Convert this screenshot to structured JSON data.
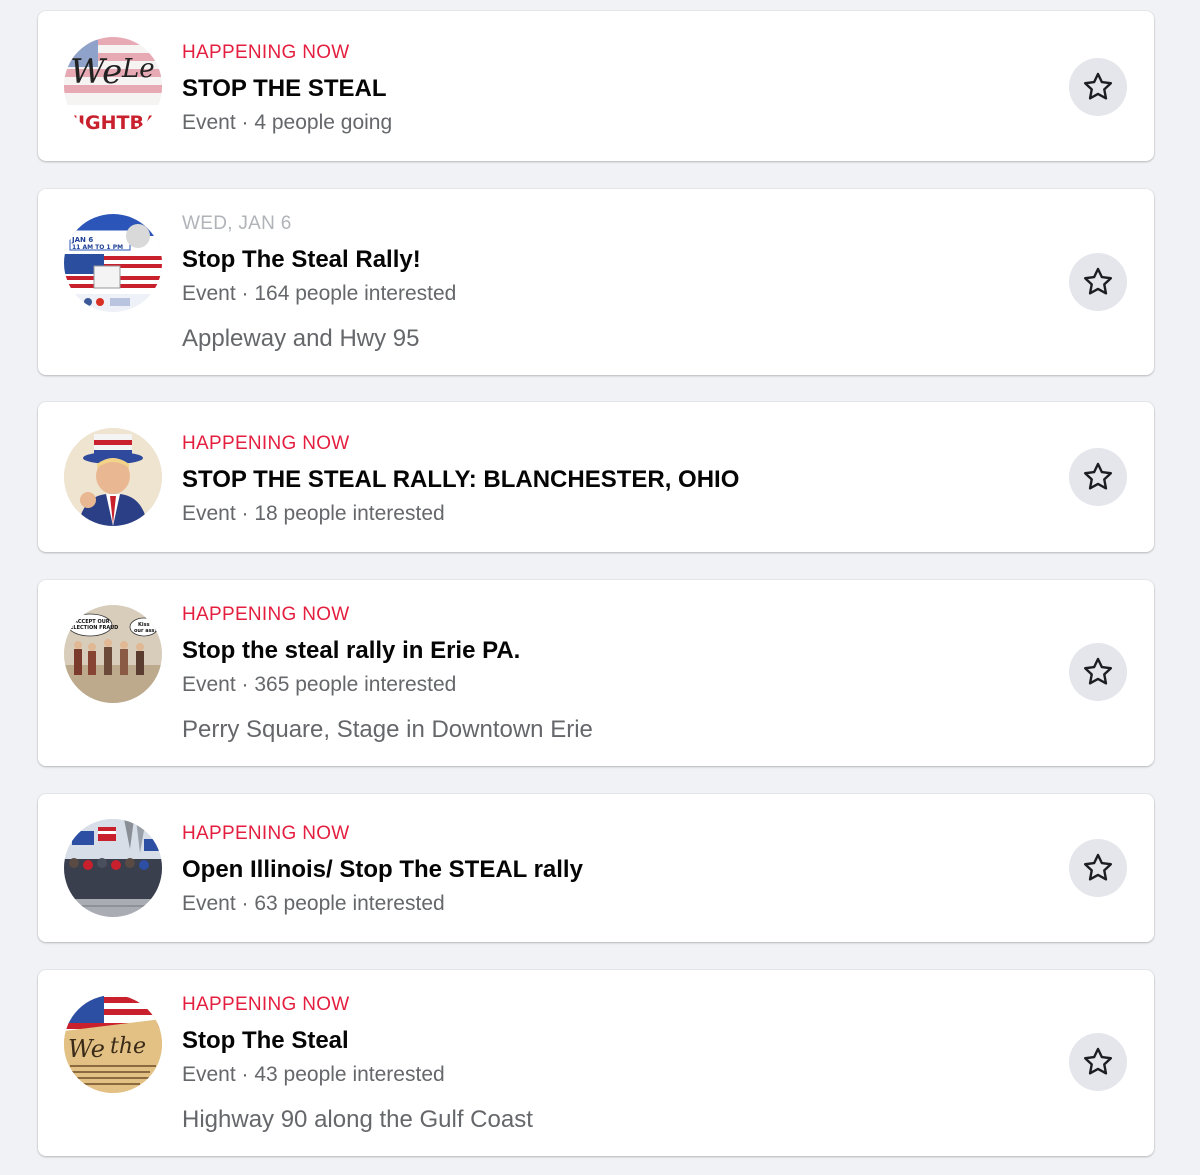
{
  "events": [
    {
      "when": "HAPPENING NOW",
      "when_type": "live",
      "title": "STOP THE STEAL",
      "meta": "Event · 4 people going",
      "location": "",
      "thumb_icon": "we-the-people-flag-image",
      "thumb_text": "FIGHTBAC"
    },
    {
      "when": "WED, JAN 6",
      "when_type": "date",
      "title": "Stop The Steal Rally!",
      "meta": "Event · 164 people interested",
      "location": "Appleway and Hwy 95",
      "thumb_icon": "rally-flyer-image",
      "thumb_text": "JAN 6 11 AM TO 1 PM"
    },
    {
      "when": "HAPPENING NOW",
      "when_type": "live",
      "title": "STOP THE STEAL RALLY: BLANCHESTER, OHIO",
      "meta": "Event · 18 people interested",
      "location": "",
      "thumb_icon": "uncle-sam-portrait-image",
      "thumb_text": ""
    },
    {
      "when": "HAPPENING NOW",
      "when_type": "live",
      "title": "Stop the steal rally in Erie PA.",
      "meta": "Event · 365 people interested",
      "location": "Perry Square, Stage in Downtown Erie",
      "thumb_icon": "cartoon-soldiers-image",
      "thumb_text": "ACCEPT OUR ELECTION FRAUD"
    },
    {
      "when": "HAPPENING NOW",
      "when_type": "live",
      "title": "Open Illinois/ Stop The STEAL rally",
      "meta": "Event · 63 people interested",
      "location": "",
      "thumb_icon": "crowd-with-flags-image",
      "thumb_text": ""
    },
    {
      "when": "HAPPENING NOW",
      "when_type": "live",
      "title": "Stop The Steal",
      "meta": "Event · 43 people interested",
      "location": "Highway 90 along the Gulf Coast",
      "thumb_icon": "constitution-flag-image",
      "thumb_text": ""
    }
  ],
  "star_icon": "star-outline-icon",
  "colors": {
    "live": "#e41e3f",
    "date": "#b0b3b8",
    "title": "#050505",
    "meta": "#65676b",
    "button_bg": "#e4e6eb",
    "page_bg": "#f0f2f5"
  }
}
